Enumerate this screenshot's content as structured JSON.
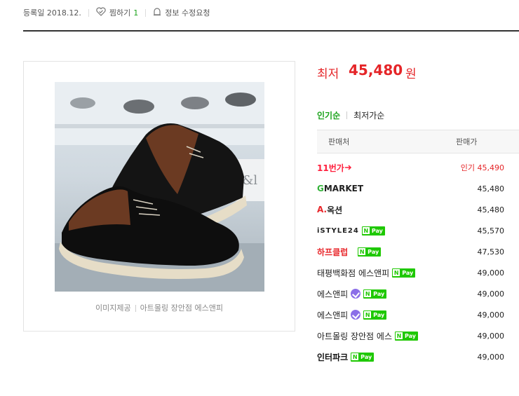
{
  "meta": {
    "registered": "등록일 2018.12.",
    "wish_label": "찜하기",
    "wish_count": "1",
    "report_label": "정보 수정요청"
  },
  "image": {
    "caption_left": "이미지제공",
    "caption_right": "아트몰링 장안점 에스앤피",
    "shop_sign": "pes&l"
  },
  "price": {
    "label": "최저",
    "value": "45,480",
    "unit": "원"
  },
  "tabs": [
    {
      "label": "인기순",
      "active": true
    },
    {
      "label": "최저가순",
      "active": false
    }
  ],
  "table": {
    "col_seller": "판매처",
    "col_price": "판매가"
  },
  "sellers": [
    {
      "logo": "11번가",
      "price": "인기 45,490"
    },
    {
      "logo_g": "G",
      "logo_rest": "MARKET",
      "price": "45,480"
    },
    {
      "logo_a": "A.",
      "logo_rest": "옥션",
      "price": "45,480"
    },
    {
      "logo": "iSTYLE24",
      "npay": "Pay",
      "price": "45,570"
    },
    {
      "logo": "하프클럽",
      "npay": "Pay",
      "price": "47,530"
    },
    {
      "name": "태평백화점 에스앤피",
      "npay": "Pay",
      "price": "49,000"
    },
    {
      "name": "에스앤피",
      "npay": "Pay",
      "price": "49,000"
    },
    {
      "name": "에스앤피",
      "npay": "Pay",
      "price": "49,000"
    },
    {
      "name": "아트몰링 장안점 에스",
      "npay": "Pay",
      "price": "49,000"
    },
    {
      "logo": "인터파크",
      "npay": "Pay",
      "price": "49,000"
    }
  ],
  "colors": {
    "accent_green": "#1ba31b",
    "price_red": "#e52528",
    "npay_green": "#1ec800"
  }
}
